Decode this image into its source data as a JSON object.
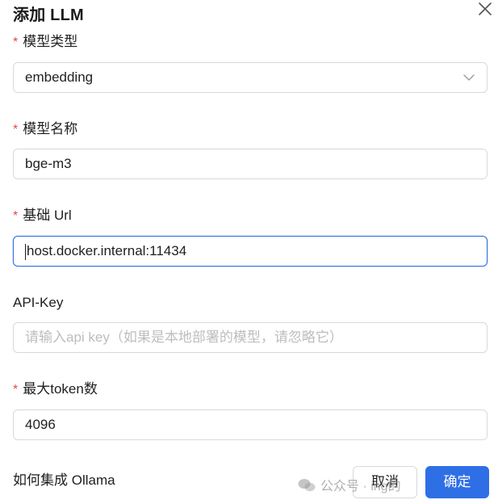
{
  "dialog": {
    "title": "添加 LLM",
    "close_icon": "close-icon"
  },
  "fields": {
    "model_type": {
      "label": "模型类型",
      "required_mark": "*",
      "value": "embedding",
      "icon": "chevron-down-icon"
    },
    "model_name": {
      "label": "模型名称",
      "required_mark": "*",
      "value": "bge-m3"
    },
    "base_url": {
      "label": "基础 Url",
      "required_mark": "*",
      "value": "host.docker.internal:11434"
    },
    "api_key": {
      "label": "API-Key",
      "value": "",
      "placeholder": "请输入api key（如果是本地部署的模型，请忽略它）"
    },
    "max_tokens": {
      "label": "最大token数",
      "required_mark": "*",
      "value": "4096"
    }
  },
  "footer": {
    "help_text": "如何集成 Ollama",
    "cancel_label": "取消",
    "ok_label": "确定"
  },
  "watermark": {
    "text": "公众号 · ing的"
  },
  "colors": {
    "accent": "#2f6fe6",
    "required": "#e5484d",
    "border": "#d9d9d9",
    "placeholder": "#bdbdbd"
  }
}
